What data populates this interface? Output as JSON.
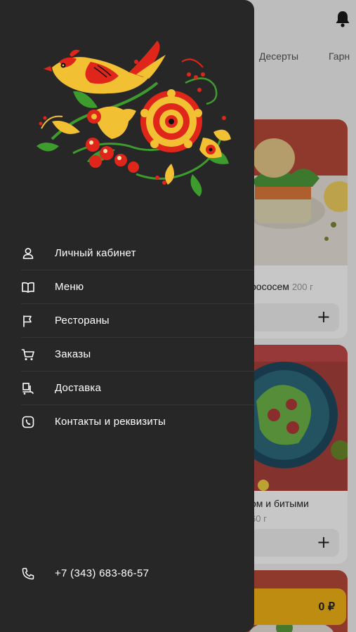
{
  "background_screen": {
    "categories": [
      "Десерты",
      "Гарн"
    ],
    "cards": [
      {
        "title": "рососем",
        "weight": "200 г",
        "add_symbol": "+"
      },
      {
        "title": "ом и битыми",
        "weight": "60 г",
        "add_symbol": "+"
      }
    ],
    "cart_total": "0 ₽"
  },
  "drawer": {
    "menu": [
      {
        "label": "Личный кабинет",
        "icon": "user-icon"
      },
      {
        "label": "Меню",
        "icon": "book-icon"
      },
      {
        "label": "Рестораны",
        "icon": "flag-icon"
      },
      {
        "label": "Заказы",
        "icon": "cart-icon"
      },
      {
        "label": "Доставка",
        "icon": "delivery-icon"
      },
      {
        "label": "Контакты и реквизиты",
        "icon": "contacts-icon"
      }
    ],
    "phone": "+7 (343) 683-86-57"
  },
  "colors": {
    "drawer_bg": "#272727",
    "accent_yellow": "#f5b418",
    "logo_red": "#e0261b",
    "logo_green": "#3e9b2e"
  }
}
